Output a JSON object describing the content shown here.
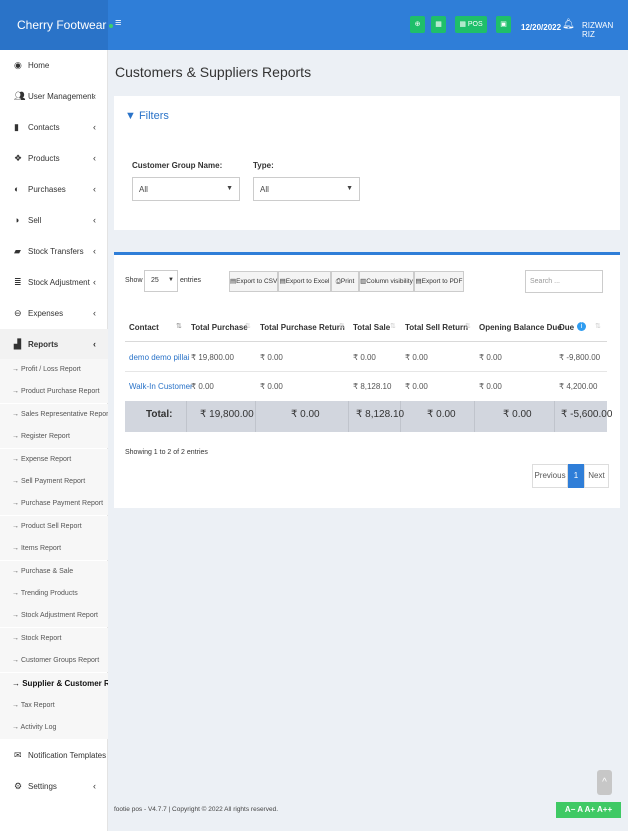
{
  "brand": "Cherry Footwear",
  "topbar": {
    "menu_glyph": "≡",
    "pos_label": "POS",
    "date": "12/20/2022",
    "user": "RIZWAN RIZ"
  },
  "sidebar": {
    "items": [
      {
        "label": "Home",
        "icon": "tachometer-icon"
      },
      {
        "label": "User Management",
        "icon": "users-icon"
      },
      {
        "label": "Contacts",
        "icon": "address-book-icon"
      },
      {
        "label": "Products",
        "icon": "cubes-icon"
      },
      {
        "label": "Purchases",
        "icon": "arrow-circle-down-icon"
      },
      {
        "label": "Sell",
        "icon": "arrow-circle-up-icon"
      },
      {
        "label": "Stock Transfers",
        "icon": "truck-icon"
      },
      {
        "label": "Stock Adjustment",
        "icon": "database-icon"
      },
      {
        "label": "Expenses",
        "icon": "minus-circle-icon"
      },
      {
        "label": "Reports",
        "icon": "chart-icon"
      }
    ],
    "reports_sub": [
      "→ Profit / Loss Report",
      "→ Product Purchase Report",
      "→ Sales Representative Report",
      "→ Register Report",
      "→ Expense Report",
      "→ Sell Payment Report",
      "→ Purchase Payment Report",
      "→ Product Sell Report",
      "→ Items Report",
      "→ Purchase & Sale",
      "→ Trending Products",
      "→ Stock Adjustment Report",
      "→ Stock Report",
      "→ Customer Groups Report",
      "→ Supplier & Customer Rep",
      "→ Tax Report",
      "→ Activity Log"
    ],
    "bottom_items": [
      {
        "label": "Notification Templates",
        "icon": "envelope-icon"
      },
      {
        "label": "Settings",
        "icon": "cog-icon"
      }
    ]
  },
  "page": {
    "title": "Customers & Suppliers Reports"
  },
  "filters": {
    "title": "Filters",
    "customer_group_label": "Customer Group Name:",
    "customer_group_value": "All",
    "type_label": "Type:",
    "type_value": "All"
  },
  "table_controls": {
    "show": "Show",
    "length": "25",
    "entries": "entries",
    "buttons": [
      "Export to CSV",
      "Export to Excel",
      "Print",
      "Column visibility",
      "Export to PDF"
    ],
    "search_placeholder": "Search ..."
  },
  "table": {
    "headers": [
      "Contact",
      "Total Purchase",
      "Total Purchase Return",
      "Total Sale",
      "Total Sell Return",
      "Opening Balance Due",
      "Due"
    ],
    "rows": [
      [
        "demo demo pillai",
        "₹ 19,800.00",
        "₹ 0.00",
        "₹ 0.00",
        "₹ 0.00",
        "₹ 0.00",
        "₹ -9,800.00"
      ],
      [
        "Walk-In Customer",
        "₹ 0.00",
        "₹ 0.00",
        "₹ 8,128.10",
        "₹ 0.00",
        "₹ 0.00",
        "₹ 4,200.00"
      ]
    ],
    "totals": [
      "Total:",
      "₹ 19,800.00",
      "₹ 0.00",
      "₹ 8,128.10",
      "₹ 0.00",
      "₹ 0.00",
      "₹ -5,600.00"
    ]
  },
  "info": "Showing 1 to 2 of 2 entries",
  "pagination": {
    "previous": "Previous",
    "current": "1",
    "next": "Next"
  },
  "footer": "footie pos - V4.7.7 | Copyright © 2022 All rights reserved.",
  "font_controls": "A− A A+ A++",
  "colors": {
    "primary": "#2f7ed8",
    "success": "#1fbf6a"
  }
}
